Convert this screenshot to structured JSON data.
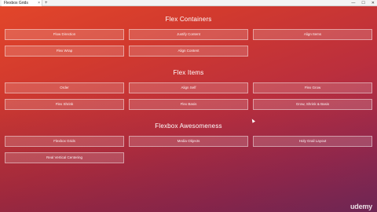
{
  "browser": {
    "tab_title": "Flexbox Grids",
    "tab_close": "×",
    "new_tab": "+",
    "minimize": "—",
    "maximize": "☐",
    "close": "✕"
  },
  "sections": {
    "containers": {
      "title": "Flex Containers",
      "items": [
        "Flow Direction",
        "Justify Content",
        "Align Items",
        "Flex Wrap",
        "Align Content"
      ]
    },
    "items": {
      "title": "Flex Items",
      "items": [
        "Order",
        "Align Self",
        "Flex Grow",
        "Flex Shrink",
        "Flex Basis",
        "Grow, Shrink & Basis"
      ]
    },
    "awesomeness": {
      "title": "Flexbox Awesomeness",
      "items": [
        "Flexbox Grids",
        "Media Objects",
        "Holy Grail Layout",
        "Real Vertical Centering"
      ]
    }
  },
  "watermark": "udemy"
}
